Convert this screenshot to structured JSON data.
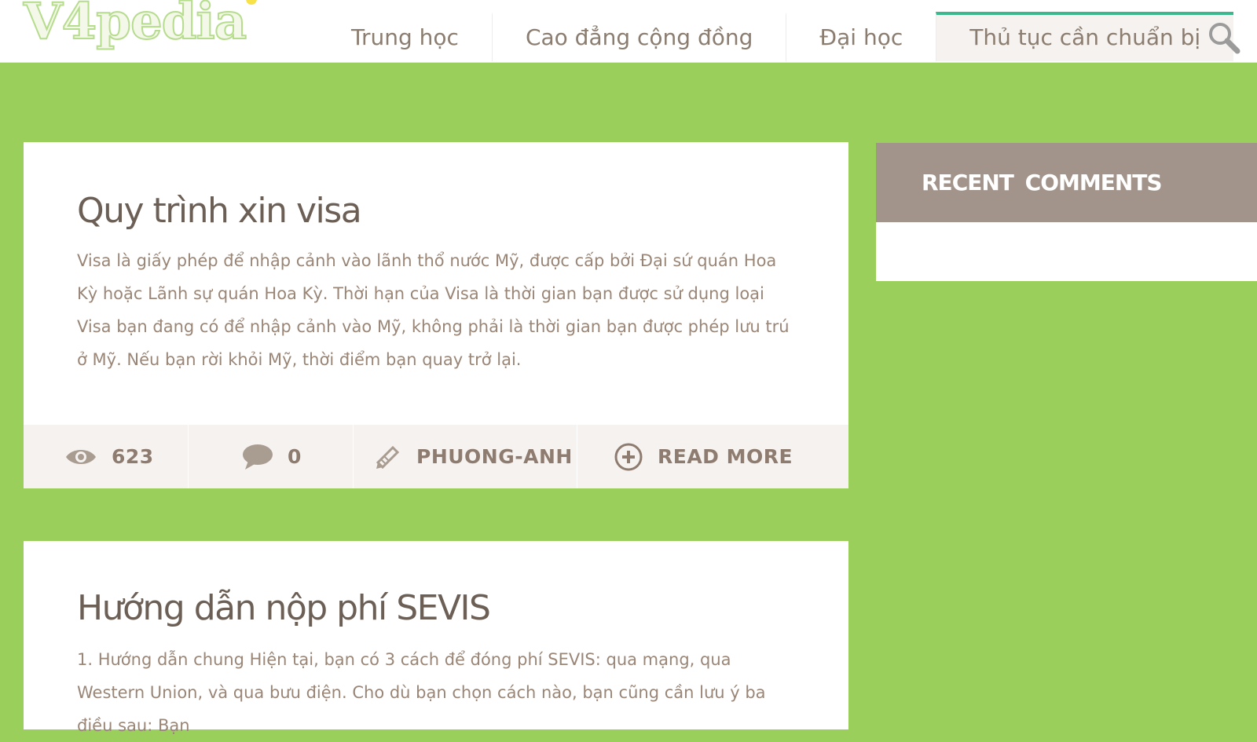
{
  "site": {
    "logo_text": "V4pedia"
  },
  "nav": {
    "items": [
      {
        "label": "Trung học"
      },
      {
        "label": "Cao đẳng cộng đồng"
      },
      {
        "label": "Đại học"
      },
      {
        "label": "Thủ tục cần chuẩn bị",
        "active": true
      }
    ],
    "search_icon": "search-icon"
  },
  "posts": [
    {
      "title": "Quy trình xin visa",
      "excerpt": "Visa là giấy phép để nhập cảnh vào lãnh thổ nước Mỹ, được cấp bởi Đại sứ quán Hoa Kỳ hoặc Lãnh sự quán Hoa Kỳ. Thời hạn của Visa là thời gian bạn được sử dụng loại Visa bạn đang có để nhập cảnh vào Mỹ, không phải là thời gian bạn được phép lưu trú ở Mỹ. Nếu bạn rời khỏi Mỹ, thời điểm bạn quay trở lại.",
      "views": "623",
      "comments": "0",
      "author": "PHUONG-ANH",
      "read_more": "READ MORE"
    },
    {
      "title": "Hướng dẫn nộp phí SEVIS",
      "excerpt": "1. Hướng dẫn chung Hiện tại, bạn có 3 cách để đóng phí SEVIS: qua mạng, qua Western Union, và qua bưu điện. Cho dù bạn chọn cách nào, bạn cũng cần lưu ý ba điều sau: Bạn"
    }
  ],
  "sidebar": {
    "widget_title": "RECENT  COMMENTS"
  },
  "colors": {
    "page_bg": "#9bcf5c",
    "accent": "#3cb88e",
    "widget_head": "#a2948a",
    "meta_bg": "#f6f2ef",
    "title_text": "#6c5f55",
    "body_text": "#9a8677"
  }
}
